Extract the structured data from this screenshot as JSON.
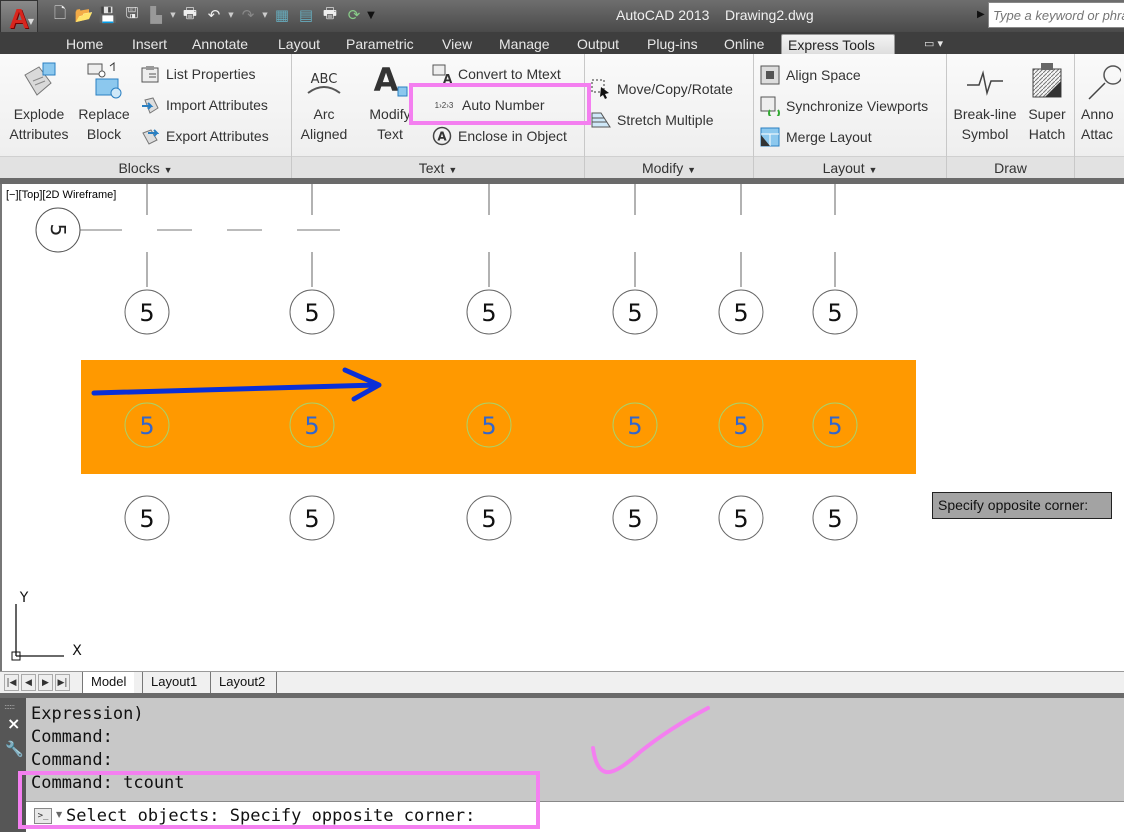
{
  "titlebar": {
    "app_name": "AutoCAD 2013",
    "document": "Drawing2.dwg",
    "search_placeholder": "Type a keyword or phrase"
  },
  "quick_access": [
    {
      "icon": "new-icon"
    },
    {
      "icon": "open-icon"
    },
    {
      "icon": "save-icon"
    },
    {
      "icon": "save-as-icon"
    },
    {
      "icon": "publish-icon"
    },
    {
      "icon": "plot-icon"
    },
    {
      "icon": "undo-icon"
    },
    {
      "icon": "redo-icon"
    },
    {
      "icon": "sheet-set-icon"
    },
    {
      "icon": "properties-icon"
    },
    {
      "icon": "batch-plot-icon"
    },
    {
      "icon": "sync-icon"
    },
    {
      "icon": "customize-icon"
    }
  ],
  "ribbon_tabs": [
    {
      "label": "Home"
    },
    {
      "label": "Insert"
    },
    {
      "label": "Annotate"
    },
    {
      "label": "Layout"
    },
    {
      "label": "Parametric"
    },
    {
      "label": "View"
    },
    {
      "label": "Manage"
    },
    {
      "label": "Output"
    },
    {
      "label": "Plug-ins"
    },
    {
      "label": "Online"
    },
    {
      "label": "Express Tools",
      "active": true
    }
  ],
  "panels": {
    "blocks": {
      "title": "Blocks",
      "explode_line1": "Explode",
      "explode_line2": "Attributes",
      "replace_line1": "Replace",
      "replace_line2": "Block",
      "list_properties": "List Properties",
      "import_attributes": "Import Attributes",
      "export_attributes": "Export Attributes"
    },
    "text": {
      "title": "Text",
      "arc_line1": "Arc",
      "arc_line2": "Aligned",
      "modify_line1": "Modify",
      "modify_line2": "Text",
      "convert_mtext": "Convert to Mtext",
      "auto_number": "Auto Number",
      "enclose": "Enclose in Object",
      "auto_number_glyph": "1›2›3",
      "abc_glyph": "ABC"
    },
    "modify": {
      "title": "Modify",
      "move_copy_rotate": "Move/Copy/Rotate",
      "stretch_multiple": "Stretch Multiple"
    },
    "layout": {
      "title": "Layout",
      "align_space": "Align Space",
      "sync_viewports": "Synchronize Viewports",
      "merge_layout": "Merge Layout"
    },
    "draw": {
      "title": "Draw",
      "breakline_line1": "Break-line",
      "breakline_line2": "Symbol",
      "superhatch_line1": "Super",
      "superhatch_line2": "Hatch"
    },
    "annotation": {
      "line1": "Anno",
      "line2": "Attac"
    }
  },
  "viewport": {
    "label": "[−][Top][2D Wireframe]",
    "bubble_text": "5",
    "axis_x": "X",
    "axis_y": "Y",
    "selection_color": "#ff9900",
    "arrow_color": "#0a2fd6"
  },
  "tooltip": "Specify opposite corner:",
  "layout_tabs": [
    {
      "label": "Model",
      "active": true
    },
    {
      "label": "Layout1"
    },
    {
      "label": "Layout2"
    }
  ],
  "command_history": [
    "Expression)",
    "Command:",
    "Command:",
    "Command: tcount"
  ],
  "command_input": "Select objects: Specify opposite corner:",
  "annotation_color": "#f47ff0"
}
